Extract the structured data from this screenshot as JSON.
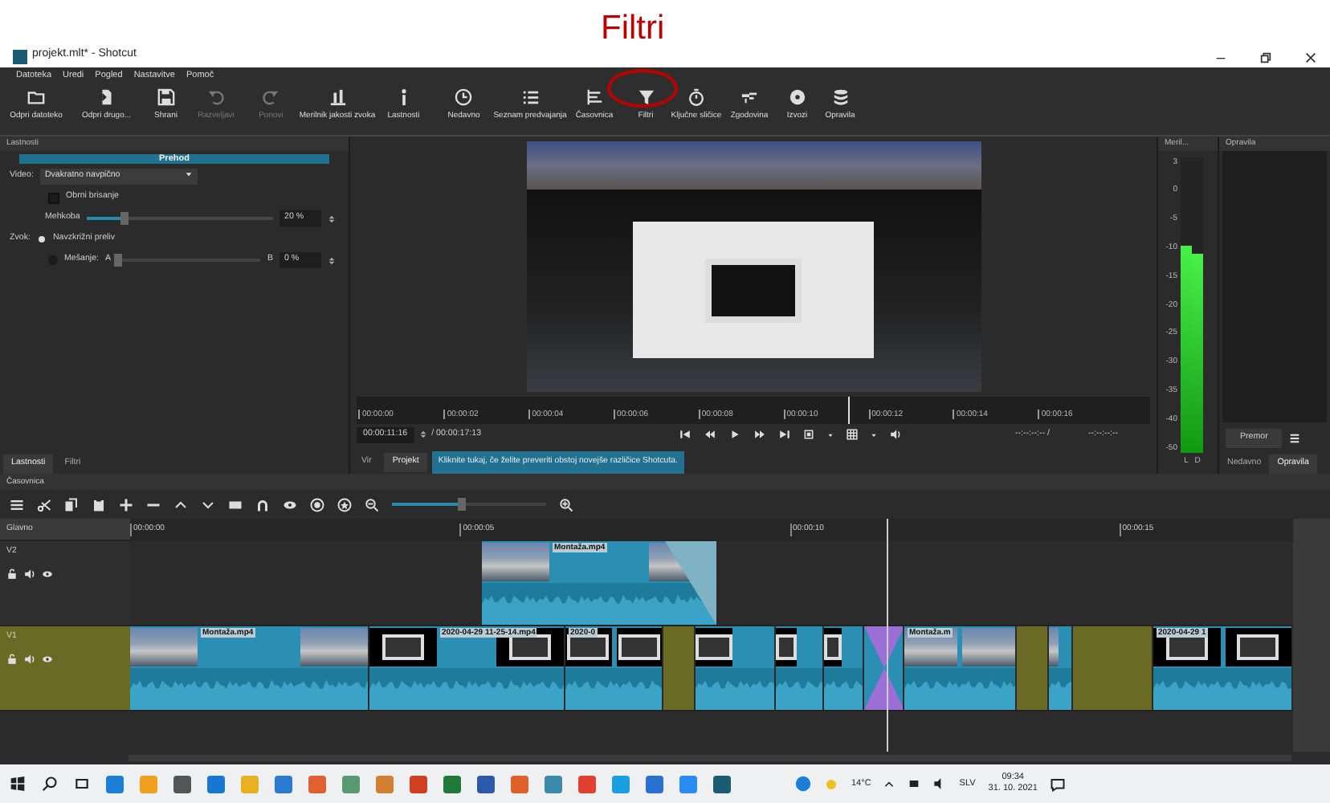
{
  "annotation": {
    "label": "Filtri"
  },
  "window": {
    "title": "projekt.mlt* - Shotcut"
  },
  "menu": [
    "Datoteka",
    "Uredi",
    "Pogled",
    "Nastavitve",
    "Pomoč"
  ],
  "toolbar": [
    {
      "label": "Odpri datoteko",
      "disabled": false
    },
    {
      "label": "Odpri drugo...",
      "disabled": false
    },
    {
      "label": "Shrani",
      "disabled": false
    },
    {
      "label": "Razveljavi",
      "disabled": true
    },
    {
      "label": "Ponovi",
      "disabled": true
    },
    {
      "label": "Merilnik jakosti zvoka",
      "disabled": false
    },
    {
      "label": "Lastnosti",
      "disabled": false
    },
    {
      "label": "Nedavno",
      "disabled": false
    },
    {
      "label": "Seznam predvajanja",
      "disabled": false
    },
    {
      "label": "Časovnica",
      "disabled": false
    },
    {
      "label": "Filtri",
      "disabled": false
    },
    {
      "label": "Ključne sličice",
      "disabled": false
    },
    {
      "label": "Zgodovina",
      "disabled": false
    },
    {
      "label": "Izvozi",
      "disabled": false
    },
    {
      "label": "Opravila",
      "disabled": false
    }
  ],
  "properties": {
    "title": "Lastnosti",
    "header": "Prehod",
    "video_label": "Video:",
    "video_value": "Dvakratno navpično",
    "reverse": {
      "label": "Obrni brisanje",
      "checked": false
    },
    "softness": {
      "label": "Mehkoba",
      "level": 0.2,
      "value": "20 %"
    },
    "audio_label": "Zvok:",
    "audio_options": [
      {
        "label": "Navzkrižni preliv",
        "selected": true
      },
      {
        "label": "Mešanje:",
        "selected": false
      }
    ],
    "mix": {
      "a": "A",
      "b": "B",
      "level": 0,
      "value": "0 %"
    },
    "tabs": [
      {
        "label": "Lastnosti",
        "selected": true
      },
      {
        "label": "Filtri",
        "selected": false
      }
    ]
  },
  "player": {
    "ruler": [
      "00:00:00",
      "00:00:02",
      "00:00:04",
      "00:00:06",
      "00:00:08",
      "00:00:10",
      "00:00:12",
      "00:00:14",
      "00:00:16"
    ],
    "playhead": {
      "level": 0.62
    },
    "timecode": "00:00:11:16",
    "duration": "/ 00:00:17:13",
    "in_point": "--:--:--:-- /",
    "out_point": "--:--:--:--",
    "tabs": [
      {
        "label": "Vir",
        "selected": false
      },
      {
        "label": "Projekt",
        "selected": true
      }
    ],
    "notice": "Kliknite tukaj, če želite preveriti obstoj novejše različice Shotcuta."
  },
  "meter": {
    "title": "Meril...",
    "scale": [
      "3",
      "0",
      "-5",
      "-10",
      "-15",
      "-20",
      "-25",
      "-30",
      "-35",
      "-40",
      "-50"
    ],
    "channels": [
      {
        "label": "L",
        "level": 0.7
      },
      {
        "label": "D",
        "level": 0.67
      }
    ]
  },
  "jobs": {
    "title": "Opravila",
    "pause": "Premor",
    "tabs": [
      {
        "label": "Nedavno",
        "selected": false
      },
      {
        "label": "Opravila",
        "selected": true
      }
    ]
  },
  "timeline": {
    "title": "Časovnica",
    "zoom": {
      "level": 0.45
    },
    "header": "Glavno",
    "ruler": [
      "00:00:00",
      "00:00:05",
      "00:00:10",
      "00:00:15"
    ],
    "playhead": {
      "level": 0.65
    },
    "tracks": [
      {
        "name": "V2",
        "selected": false,
        "clips": [
          {
            "kind": "footage",
            "title": "Montaža.mp4"
          }
        ]
      },
      {
        "name": "V1",
        "selected": true,
        "clips": [
          {
            "kind": "footage",
            "title": "Montaža.mp4"
          },
          {
            "kind": "screencast",
            "title": "2020-04-29 11-25-14.mp4"
          },
          {
            "kind": "screencast",
            "title": "2020-0"
          },
          {
            "kind": "gap"
          },
          {
            "kind": "screencast"
          },
          {
            "kind": "screencast"
          },
          {
            "kind": "screencast"
          },
          {
            "kind": "transition"
          },
          {
            "kind": "footage",
            "title": "Montaža.m"
          },
          {
            "kind": "gap"
          },
          {
            "kind": "footage"
          },
          {
            "kind": "gap"
          },
          {
            "kind": "screencast",
            "title": "2020-04-29 1"
          }
        ]
      }
    ]
  },
  "taskbar": {
    "weather": "14°C",
    "language": "SLV",
    "time": "09:34",
    "date": "31. 10. 2021"
  }
}
